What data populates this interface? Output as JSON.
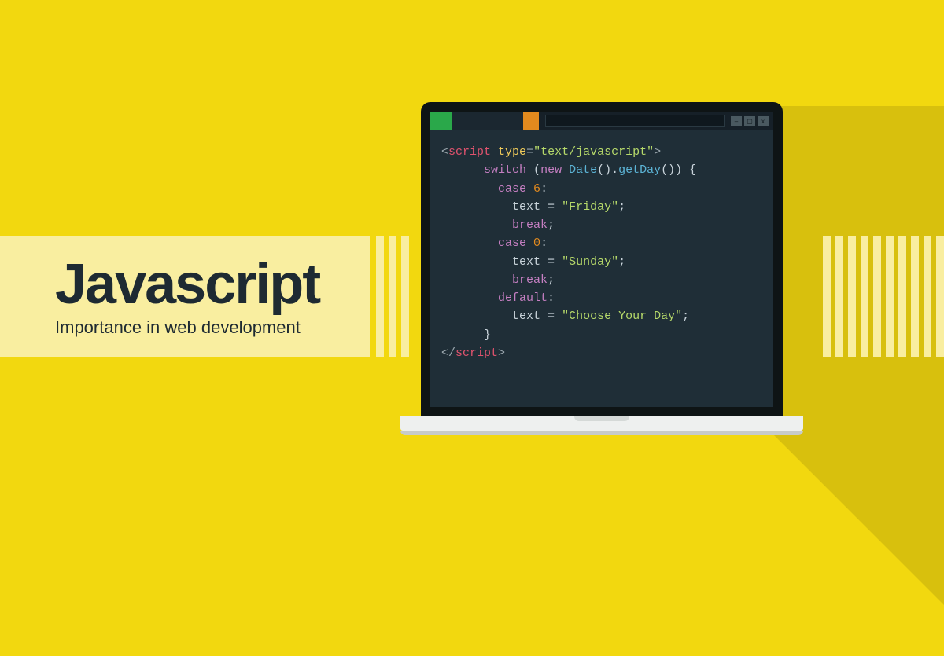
{
  "title": "Javascript",
  "subtitle": "Importance in web development",
  "window_icons": {
    "minimize": "–",
    "maximize": "▢",
    "close": "x"
  },
  "code": {
    "open_tag": {
      "name": "script",
      "attr": "type",
      "value": "\"text/javascript\""
    },
    "switch_kw": "switch",
    "new_kw": "new",
    "date_fn": "Date",
    "getday_fn": "getDay",
    "case_kw": "case",
    "break_kw": "break",
    "default_kw": "default",
    "text_var": "text",
    "case1_num": "6",
    "case1_str": "\"Friday\"",
    "case2_num": "0",
    "case2_str": "\"Sunday\"",
    "default_str": "\"Choose Your Day\"",
    "close_tag": "script"
  }
}
